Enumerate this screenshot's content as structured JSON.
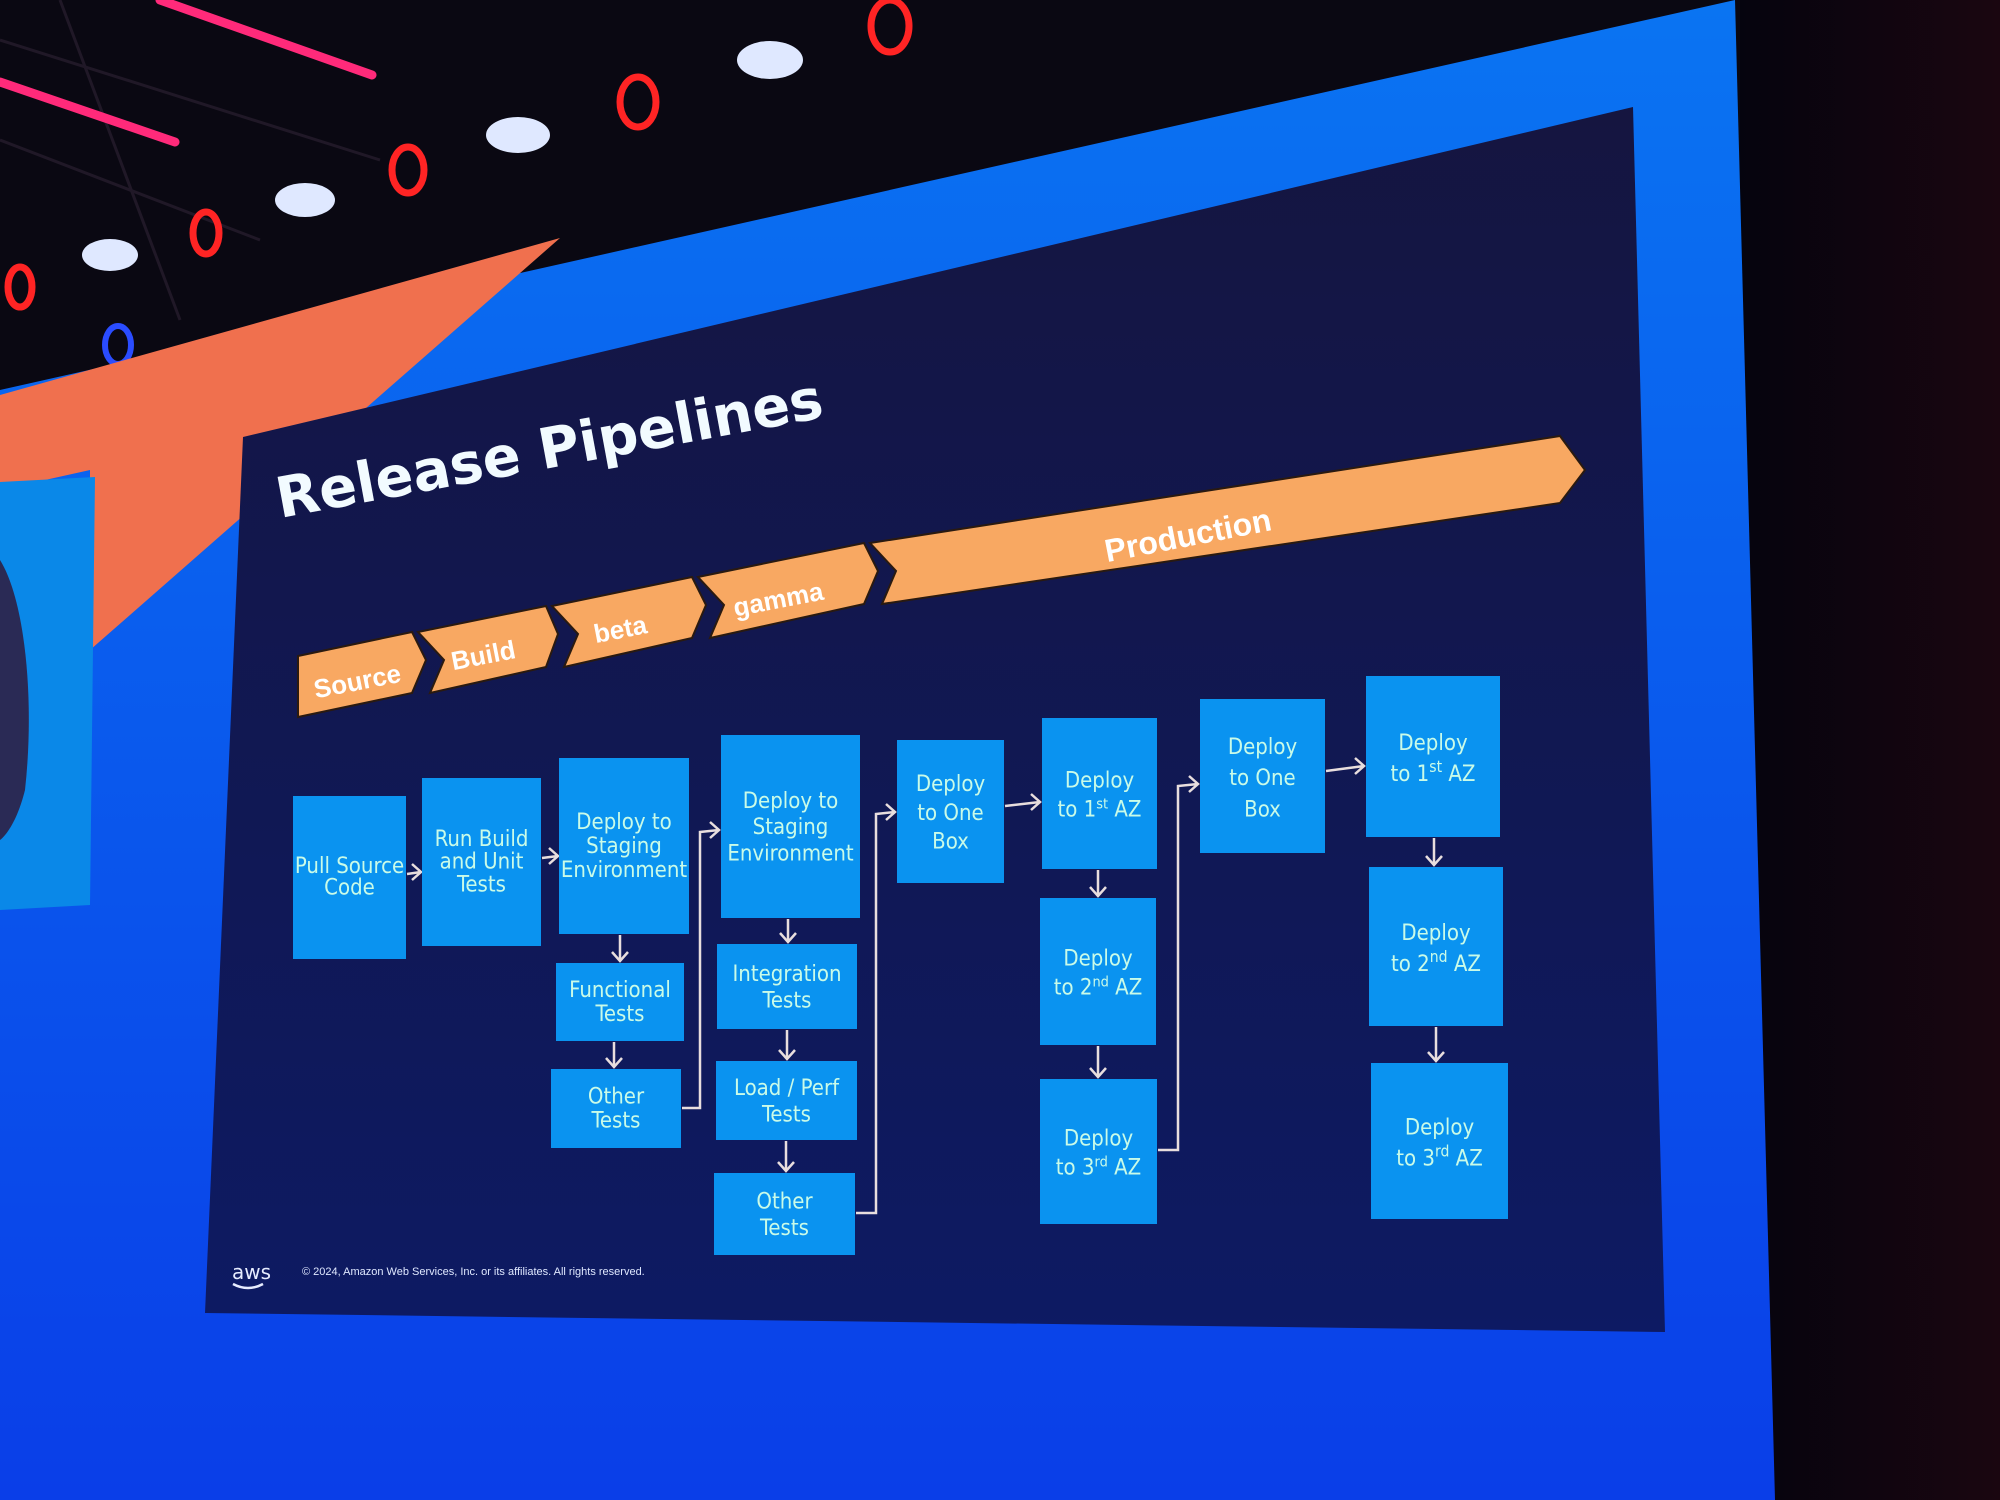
{
  "slide": {
    "title": "Release Pipelines",
    "stages": [
      {
        "label": "Source"
      },
      {
        "label": "Build"
      },
      {
        "label": "beta"
      },
      {
        "label": "gamma"
      },
      {
        "label": "Production"
      }
    ],
    "steps": {
      "pull_source": [
        "Pull Source",
        "Code"
      ],
      "run_build": [
        "Run Build",
        "and Unit",
        "Tests"
      ],
      "beta_deploy": [
        "Deploy to",
        "Staging",
        "Environment"
      ],
      "beta_functional": [
        "Functional",
        "Tests"
      ],
      "beta_other": [
        "Other",
        "Tests"
      ],
      "gamma_deploy": [
        "Deploy to",
        "Staging",
        "Environment"
      ],
      "gamma_integration": [
        "Integration",
        "Tests"
      ],
      "gamma_load": [
        "Load / Perf",
        "Tests"
      ],
      "gamma_other": [
        "Other",
        "Tests"
      ],
      "prod1_onebox": [
        "Deploy",
        "to One",
        "Box"
      ],
      "prod1_az1": {
        "line1": "Deploy",
        "pre": "to 1",
        "sup": "st",
        "post": " AZ"
      },
      "prod1_az2": {
        "line1": "Deploy",
        "pre": "to 2",
        "sup": "nd",
        "post": " AZ"
      },
      "prod1_az3": {
        "line1": "Deploy",
        "pre": "to 3",
        "sup": "rd",
        "post": " AZ"
      },
      "prod2_onebox": [
        "Deploy",
        "to One",
        "Box"
      ],
      "prod2_az1": {
        "line1": "Deploy",
        "pre": "to 1",
        "sup": "st",
        "post": " AZ"
      },
      "prod2_az2": {
        "line1": "Deploy",
        "pre": "to 2",
        "sup": "nd",
        "post": " AZ"
      },
      "prod2_az3": {
        "line1": "Deploy",
        "pre": "to 3",
        "sup": "rd",
        "post": " AZ"
      }
    },
    "footer": {
      "logo": "aws",
      "copyright": "© 2024, Amazon Web Services, Inc. or its affiliates. All rights reserved."
    }
  },
  "colors": {
    "slide_bg": "#0f1a5c",
    "box": "#0a93f0",
    "box_text": "#c9fbe8",
    "stage": "#f8a862",
    "screen_blue": "#0a6cf0",
    "orange_accent": "#f0704e"
  }
}
